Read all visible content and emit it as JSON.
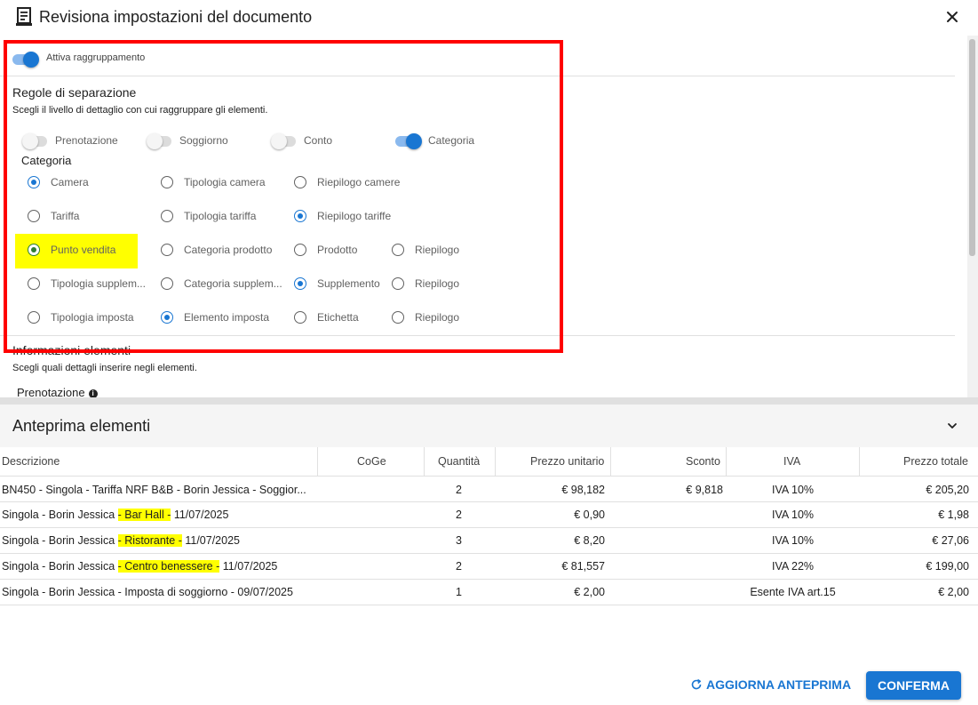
{
  "dialog": {
    "title": "Revisiona impostazioni del documento",
    "icons": {
      "doc": "document-icon",
      "close": "close-icon"
    }
  },
  "grouping": {
    "toggle_label": "Attiva raggruppamento",
    "enabled": true
  },
  "separation": {
    "title": "Regole di separazione",
    "subtitle": "Scegli il livello di dettaglio con cui raggruppare gli elementi.",
    "toggles": [
      {
        "label": "Prenotazione",
        "on": false
      },
      {
        "label": "Soggiorno",
        "on": false
      },
      {
        "label": "Conto",
        "on": false
      },
      {
        "label": "Categoria",
        "on": true
      }
    ],
    "category_title": "Categoria",
    "radio_rows": [
      [
        "Camera",
        "Tipologia camera",
        "Riepilogo camere"
      ],
      [
        "Tariffa",
        "Tipologia tariffa",
        "Riepilogo tariffe"
      ],
      [
        "Punto vendita",
        "Categoria prodotto",
        "Prodotto",
        "Riepilogo"
      ],
      [
        "Tipologia supplem...",
        "Categoria supplem...",
        "Supplemento",
        "Riepilogo"
      ],
      [
        "Tipologia imposta",
        "Elemento imposta",
        "Etichetta",
        "Riepilogo"
      ]
    ],
    "selected": [
      "Camera",
      "Riepilogo tariffe",
      "Punto vendita",
      "Supplemento",
      "Elemento imposta"
    ]
  },
  "info": {
    "title": "Informazioni elementi",
    "subtitle": "Scegli quali dettagli inserire negli elementi.",
    "item": "Prenotazione"
  },
  "preview": {
    "title": "Anteprima elementi",
    "columns": [
      "Descrizione",
      "CoGe",
      "Quantità",
      "Prezzo unitario",
      "Sconto",
      "IVA",
      "Prezzo totale"
    ],
    "rows": [
      {
        "pre": "BN450 - Singola - Tariffa NRF B&B - Borin Jessica - Soggior...",
        "hl": "",
        "post": "",
        "coge": "",
        "qty": "2",
        "unit": "€ 98,182",
        "discount": "€ 9,818",
        "iva": "IVA 10%",
        "total": "€ 205,20"
      },
      {
        "pre": "Singola - Borin Jessica ",
        "hl": "- Bar Hall -",
        "post": " 11/07/2025",
        "coge": "",
        "qty": "2",
        "unit": "€ 0,90",
        "discount": "",
        "iva": "IVA 10%",
        "total": "€ 1,98"
      },
      {
        "pre": "Singola - Borin Jessica ",
        "hl": "- Ristorante -",
        "post": " 11/07/2025",
        "coge": "",
        "qty": "3",
        "unit": "€ 8,20",
        "discount": "",
        "iva": "IVA 10%",
        "total": "€ 27,06"
      },
      {
        "pre": "Singola - Borin Jessica ",
        "hl": "- Centro benessere -",
        "post": " 11/07/2025",
        "coge": "",
        "qty": "2",
        "unit": "€ 81,557",
        "discount": "",
        "iva": "IVA 22%",
        "total": "€ 199,00"
      },
      {
        "pre": "Singola - Borin Jessica - Imposta di soggiorno - 09/07/2025",
        "hl": "",
        "post": "",
        "coge": "",
        "qty": "1",
        "unit": "€ 2,00",
        "discount": "",
        "iva": "Esente IVA art.15",
        "total": "€ 2,00"
      }
    ]
  },
  "footer": {
    "refresh_label": "AGGIORNA ANTEPRIMA",
    "confirm_label": "CONFERMA"
  },
  "colors": {
    "accent": "#1976d2",
    "highlight": "#ffff00",
    "annotation": "#ff0000"
  }
}
